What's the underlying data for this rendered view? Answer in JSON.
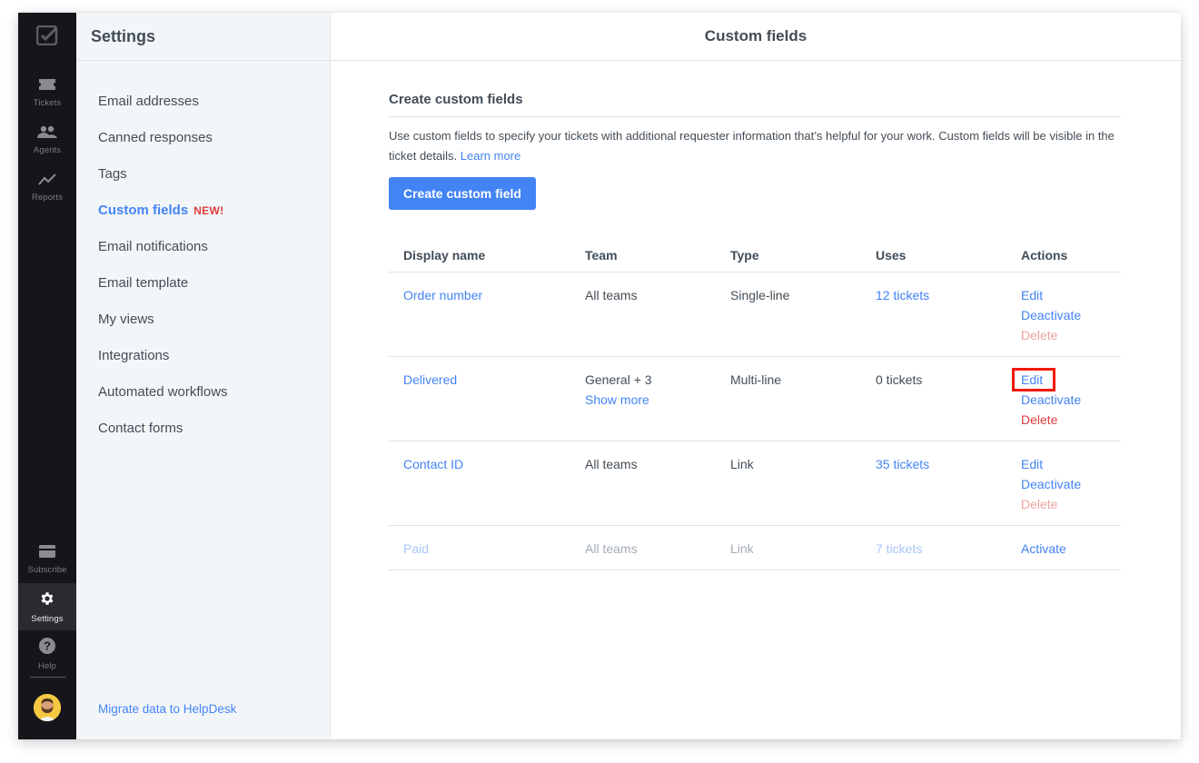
{
  "rail": {
    "logo": "helpdesk-logo",
    "items": [
      {
        "label": "Tickets",
        "icon": "ticket-icon"
      },
      {
        "label": "Agents",
        "icon": "agents-icon"
      },
      {
        "label": "Reports",
        "icon": "reports-icon"
      }
    ],
    "bottom_items": [
      {
        "label": "Subscribe",
        "icon": "card-icon"
      },
      {
        "label": "Settings",
        "icon": "gear-icon",
        "active": true
      },
      {
        "label": "Help",
        "icon": "help-icon"
      }
    ]
  },
  "sidebar": {
    "title": "Settings",
    "items": [
      {
        "label": "Email addresses"
      },
      {
        "label": "Canned responses"
      },
      {
        "label": "Tags"
      },
      {
        "label": "Custom fields",
        "badge": "NEW!",
        "active": true
      },
      {
        "label": "Email notifications"
      },
      {
        "label": "Email template"
      },
      {
        "label": "My views"
      },
      {
        "label": "Integrations"
      },
      {
        "label": "Automated workflows"
      },
      {
        "label": "Contact forms"
      }
    ],
    "footer_link": "Migrate data to HelpDesk"
  },
  "main": {
    "title": "Custom fields",
    "section_title": "Create custom fields",
    "description": "Use custom fields to specify your tickets with additional requester information that’s helpful for your work. Custom fields will be visible in the ticket details.",
    "learn_more": "Learn more",
    "create_button": "Create custom field",
    "table": {
      "headers": [
        "Display name",
        "Team",
        "Type",
        "Uses",
        "Actions"
      ],
      "rows": [
        {
          "name": "Order number",
          "team": "All teams",
          "type": "Single-line",
          "uses": "12 tickets",
          "actions": [
            "Edit",
            "Deactivate",
            "Delete"
          ],
          "delete_enabled": false,
          "inactive": false
        },
        {
          "name": "Delivered",
          "team": "General + 3",
          "team_more": "Show more",
          "type": "Multi-line",
          "uses": "0 tickets",
          "actions": [
            "Edit",
            "Deactivate",
            "Delete"
          ],
          "delete_enabled": true,
          "inactive": false,
          "highlighted_action": "Edit"
        },
        {
          "name": "Contact ID",
          "team": "All teams",
          "type": "Link",
          "uses": "35 tickets",
          "actions": [
            "Edit",
            "Deactivate",
            "Delete"
          ],
          "delete_enabled": false,
          "inactive": false
        },
        {
          "name": "Paid",
          "team": "All teams",
          "type": "Link",
          "uses": "7 tickets",
          "actions": [
            "Activate"
          ],
          "inactive": true
        }
      ]
    }
  },
  "colors": {
    "accent": "#4384f5",
    "danger": "#de3d3d",
    "rail_bg": "#15151b",
    "sidebar_bg": "#f3f6f9",
    "highlight_box": "#f21a0a"
  }
}
